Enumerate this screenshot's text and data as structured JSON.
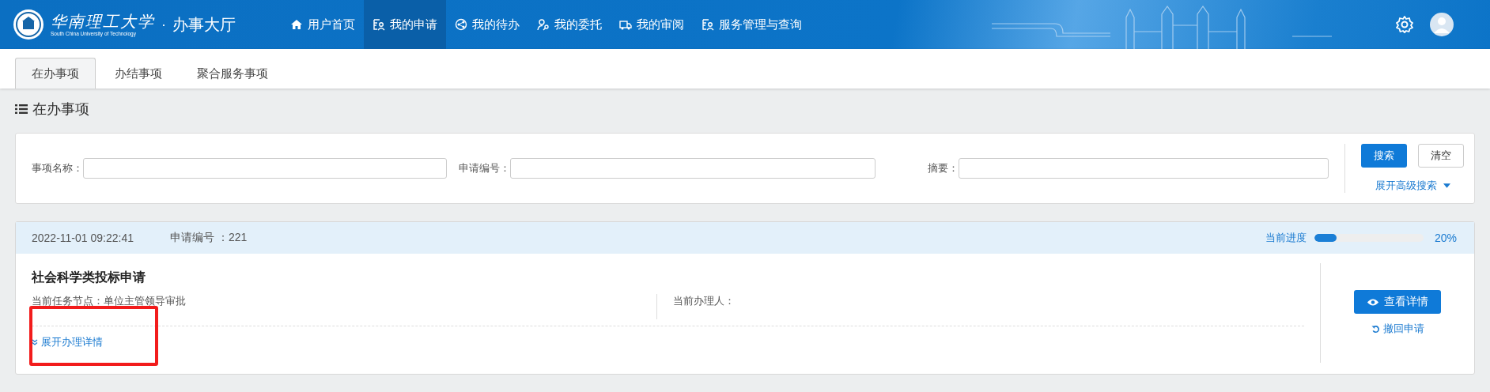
{
  "header": {
    "brand": "华南理工大学",
    "brand_en": "South China University of Technology",
    "separator": "·",
    "app_name": "办事大厅"
  },
  "nav": [
    {
      "label": "用户首页",
      "kind": "home",
      "selected": false
    },
    {
      "label": "我的申请",
      "kind": "apply",
      "selected": true
    },
    {
      "label": "我的待办",
      "kind": "todo",
      "selected": false
    },
    {
      "label": "我的委托",
      "kind": "delegate",
      "selected": false
    },
    {
      "label": "我的审阅",
      "kind": "review",
      "selected": false
    },
    {
      "label": "服务管理与查询",
      "kind": "apply",
      "selected": false
    }
  ],
  "tabs": [
    {
      "label": "在办事项",
      "selected": true
    },
    {
      "label": "办结事项",
      "selected": false
    },
    {
      "label": "聚合服务事项",
      "selected": false
    }
  ],
  "section_title": "在办事项",
  "search": {
    "fields": [
      {
        "label": "事项名称："
      },
      {
        "label": "申请编号："
      },
      {
        "label": "摘要："
      }
    ],
    "buttons": [
      {
        "label": "搜索",
        "kind": "primary"
      },
      {
        "label": "清空",
        "kind": "plain"
      }
    ],
    "advanced": "展开高级搜索"
  },
  "record": {
    "time": "2022-11-01 09:22:41",
    "number": "申请编号 ：221",
    "progress_label": "当前进度",
    "level": 0.2,
    "progress_text": "20%",
    "title": "社会科学类投标申请",
    "node": "当前任务节点：单位主管领导审批",
    "handler": "当前办理人：",
    "expand": "展开办理详情",
    "view": "查看详情",
    "withdraw": "撤回申请"
  }
}
